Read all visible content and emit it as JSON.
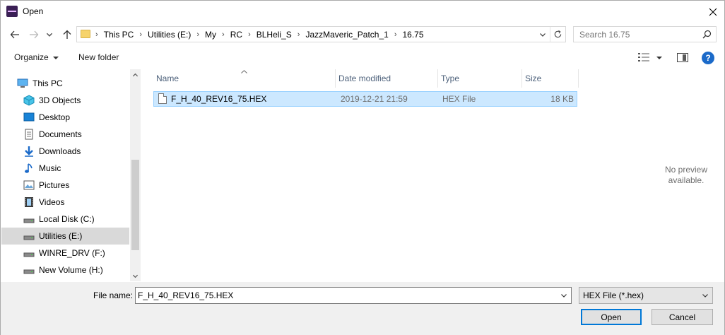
{
  "window": {
    "title": "Open"
  },
  "address": {
    "crumbs": [
      "This PC",
      "Utilities (E:)",
      "My",
      "RC",
      "BLHeli_S",
      "JazzMaveric_Patch_1",
      "16.75"
    ]
  },
  "search": {
    "placeholder": "Search 16.75"
  },
  "toolbar": {
    "organize": "Organize",
    "new_folder": "New folder",
    "help": "?"
  },
  "nav": {
    "items": [
      {
        "label": "This PC",
        "icon": "computer-icon"
      },
      {
        "label": "3D Objects",
        "icon": "cube-icon"
      },
      {
        "label": "Desktop",
        "icon": "desktop-icon"
      },
      {
        "label": "Documents",
        "icon": "document-icon"
      },
      {
        "label": "Downloads",
        "icon": "download-icon"
      },
      {
        "label": "Music",
        "icon": "music-note-icon"
      },
      {
        "label": "Pictures",
        "icon": "picture-icon"
      },
      {
        "label": "Videos",
        "icon": "film-icon"
      },
      {
        "label": "Local Disk (C:)",
        "icon": "drive-icon"
      },
      {
        "label": "Utilities (E:)",
        "icon": "drive-icon"
      },
      {
        "label": "WINRE_DRV (F:)",
        "icon": "drive-icon"
      },
      {
        "label": "New Volume (H:)",
        "icon": "drive-icon"
      }
    ],
    "selected": "Utilities (E:)"
  },
  "columns": {
    "name": "Name",
    "date": "Date modified",
    "type": "Type",
    "size": "Size"
  },
  "files": [
    {
      "name": "F_H_40_REV16_75.HEX",
      "date": "2019-12-21 21:59",
      "type": "HEX File",
      "size": "18 KB"
    }
  ],
  "preview": {
    "line1": "No preview",
    "line2": "available."
  },
  "bottom": {
    "filename_label": "File name:",
    "filename_value": "F_H_40_REV16_75.HEX",
    "filetype": "HEX File (*.hex)",
    "open": "Open",
    "cancel": "Cancel"
  },
  "colors": {
    "selection": "#cce8ff",
    "accent": "#0078d7",
    "help": "#1b6ac9"
  }
}
